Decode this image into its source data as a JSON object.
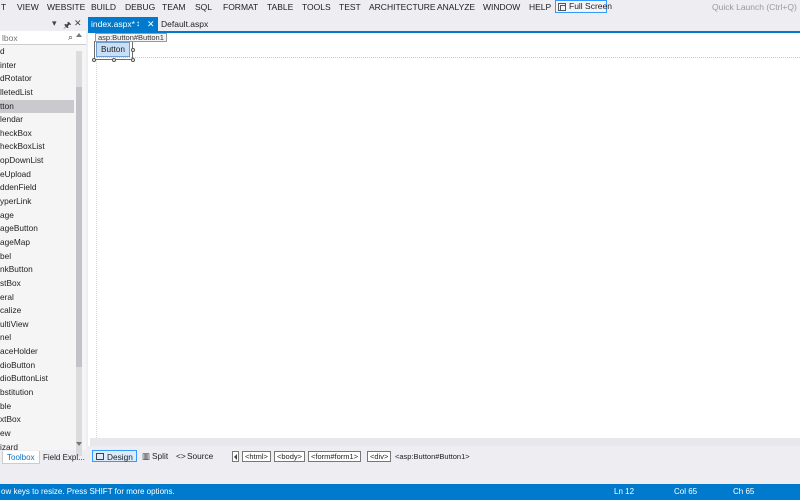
{
  "menu": {
    "items": [
      "T",
      "VIEW",
      "WEBSITE",
      "BUILD",
      "DEBUG",
      "TEAM",
      "SQL",
      "FORMAT",
      "TABLE",
      "TOOLS",
      "TEST",
      "ARCHITECTURE",
      "ANALYZE",
      "WINDOW",
      "HELP"
    ],
    "full_screen": "Full Screen",
    "quick_launch": "Quick Launch (Ctrl+Q)"
  },
  "toolbox": {
    "search_placeholder": "lbox",
    "pin_glyph": "− ⮟ ×",
    "items": [
      "d",
      "inter",
      "dRotator",
      "lletedList",
      "tton",
      "lendar",
      "heckBox",
      "heckBoxList",
      "opDownList",
      "eUpload",
      "ddenField",
      "yperLink",
      "age",
      "ageButton",
      "ageMap",
      "bel",
      "nkButton",
      "stBox",
      "eral",
      "calize",
      "ultiView",
      "nel",
      "aceHolder",
      "dioButton",
      "dioButtonList",
      "bstitution",
      "ble",
      "xtBox",
      "ew",
      "izard"
    ],
    "selected_index": 4,
    "tabs": [
      "Toolbox",
      "Field Expl..."
    ]
  },
  "doc_tabs": [
    {
      "label": "index.aspx*",
      "active": true
    },
    {
      "label": "Default.aspx",
      "active": false
    }
  ],
  "design": {
    "tag_tip": "asp:Button#Button1",
    "button_label": "Button"
  },
  "viewbar": {
    "views": [
      "Design",
      "Split",
      "Source"
    ],
    "active_view": "Design",
    "breadcrumbs": [
      "<html>",
      "<body>",
      "<form#form1>",
      "<div>",
      "<asp:Button#Button1>"
    ]
  },
  "status": {
    "message": "ow keys to resize. Press SHIFT for more options.",
    "ln": "Ln 12",
    "col": "Col 65",
    "ch": "Ch 65"
  },
  "colors": {
    "accent": "#007acc",
    "chrome": "#eeeef2",
    "selection_bg": "#c9dff5"
  }
}
